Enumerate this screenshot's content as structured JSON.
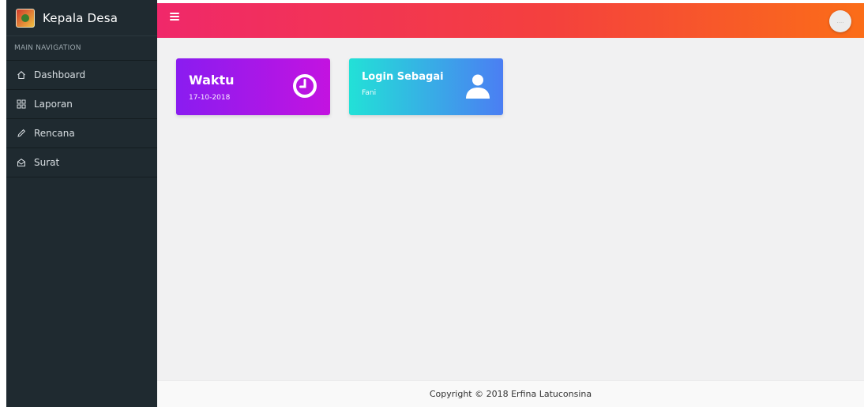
{
  "sidebar": {
    "brand_title": "Kepala Desa",
    "section_header": "MAIN NAVIGATION",
    "items": [
      {
        "label": "Dashboard",
        "icon": "home-icon"
      },
      {
        "label": "Laporan",
        "icon": "grid-icon"
      },
      {
        "label": "Rencana",
        "icon": "pencil-icon"
      },
      {
        "label": "Surat",
        "icon": "mail-open-icon"
      }
    ]
  },
  "topbar": {
    "menu_icon": "hamburger-icon",
    "avatar_label": "....",
    "gradient": [
      "#f0286a",
      "#fb6d18"
    ]
  },
  "cards": {
    "time": {
      "title": "Waktu",
      "value": "17-10-2018",
      "icon": "clock-icon",
      "gradient": [
        "#8a1cf0",
        "#c313e0"
      ]
    },
    "login": {
      "title": "Login Sebagai",
      "value": "Fani",
      "icon": "user-icon",
      "gradient": [
        "#22e1d7",
        "#4b7ef3"
      ]
    }
  },
  "footer": {
    "text": "Copyright © 2018 Erfina Latuconsina"
  }
}
